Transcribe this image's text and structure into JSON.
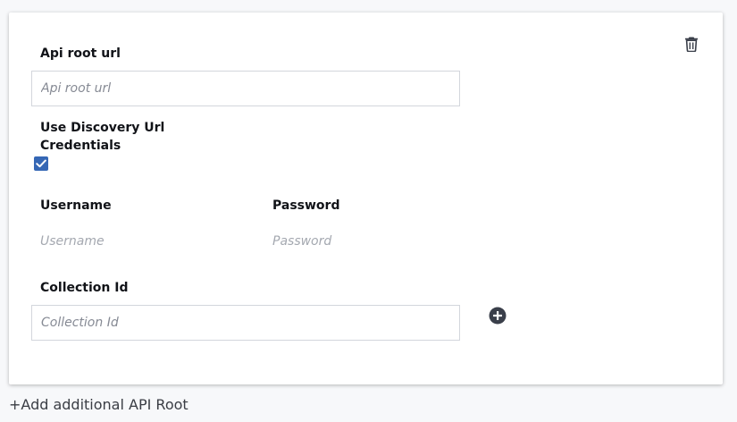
{
  "api_root": {
    "url_label": "Api root url",
    "url_placeholder": "Api root url",
    "discovery_label_line1": "Use Discovery Url",
    "discovery_label_line2": "Credentials",
    "discovery_checked": true,
    "username_label": "Username",
    "username_placeholder": "Username",
    "password_label": "Password",
    "password_placeholder": "Password",
    "collection_label": "Collection Id",
    "collection_placeholder": "Collection Id"
  },
  "icons": {
    "delete": "trash-icon",
    "add_collection": "plus-circle-icon",
    "checkbox": "checkmark-icon"
  },
  "colors": {
    "checkbox": "#3567b5",
    "icon": "#3a3f4a"
  },
  "footer": {
    "add_label": "+Add additional API Root"
  }
}
